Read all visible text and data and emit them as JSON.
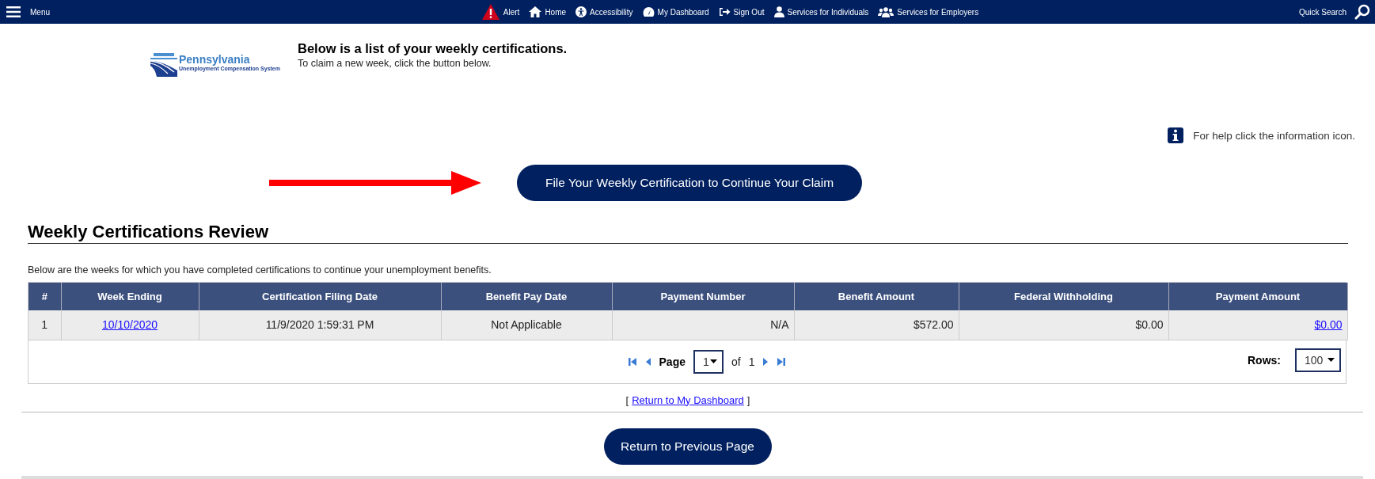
{
  "topbar": {
    "menu": "Menu",
    "nav": [
      "Alert",
      "Home",
      "Accessibility",
      "My Dashboard",
      "Sign Out",
      "Services for Individuals",
      "Services for Employers"
    ],
    "search": "Quick Search"
  },
  "logo": {
    "name": "Pennsylvania",
    "subtitle": "Unemployment Compensation System"
  },
  "intro": {
    "heading": "Below is a list of your weekly certifications.",
    "text": "To claim a new week, click the button below."
  },
  "help": "For help click the information icon.",
  "file_button": "File Your Weekly Certification to Continue Your Claim",
  "section": {
    "title": "Weekly Certifications Review",
    "description": "Below are the weeks for which you have completed certifications to continue your unemployment benefits."
  },
  "table": {
    "columns": [
      "#",
      "Week Ending",
      "Certification Filing Date",
      "Benefit Pay Date",
      "Payment Number",
      "Benefit Amount",
      "Federal Withholding",
      "Payment Amount"
    ],
    "rows": [
      [
        {
          "text": "1",
          "kind": "text"
        },
        {
          "text": "10/10/2020",
          "kind": "link"
        },
        {
          "text": "11/9/2020 1:59:31 PM",
          "kind": "text"
        },
        {
          "text": "Not Applicable",
          "kind": "text"
        },
        {
          "text": "N/A",
          "kind": "text"
        },
        {
          "text": "$572.00",
          "kind": "text"
        },
        {
          "text": "$0.00",
          "kind": "text"
        },
        {
          "text": "$0.00",
          "kind": "link"
        }
      ]
    ],
    "pager": {
      "page_label": "Page",
      "page": "1",
      "of": "of",
      "total": "1",
      "rows_label": "Rows:",
      "rows": "100"
    }
  },
  "dashboard_link": {
    "open": "[",
    "label": "Return to My Dashboard",
    "close": "]"
  },
  "back_button": "Return to Previous Page"
}
